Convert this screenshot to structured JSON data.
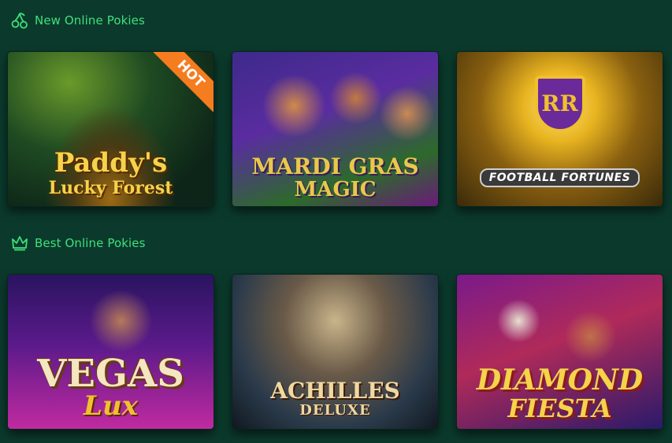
{
  "sections": [
    {
      "title": "New Online Pokies",
      "icon": "cherry-icon",
      "games": [
        {
          "line1": "Paddy's",
          "line2": "Lucky Forest",
          "badge": "HOT"
        },
        {
          "line1": "MARDI GRAS",
          "line2": "MAGIC"
        },
        {
          "line1": "FOOTBALL FORTUNES",
          "crest": "RR"
        }
      ]
    },
    {
      "title": "Best Online Pokies",
      "icon": "crown-icon",
      "games": [
        {
          "line1": "VEGAS",
          "line2": "Lux"
        },
        {
          "line1": "ACHILLES",
          "line2": "DELUXE"
        },
        {
          "line1": "DIAMOND",
          "line2": "FIESTA"
        }
      ]
    }
  ],
  "colors": {
    "background": "#0b3a2c",
    "accent": "#3fe07a",
    "hot_badge": "#f57c1f"
  }
}
